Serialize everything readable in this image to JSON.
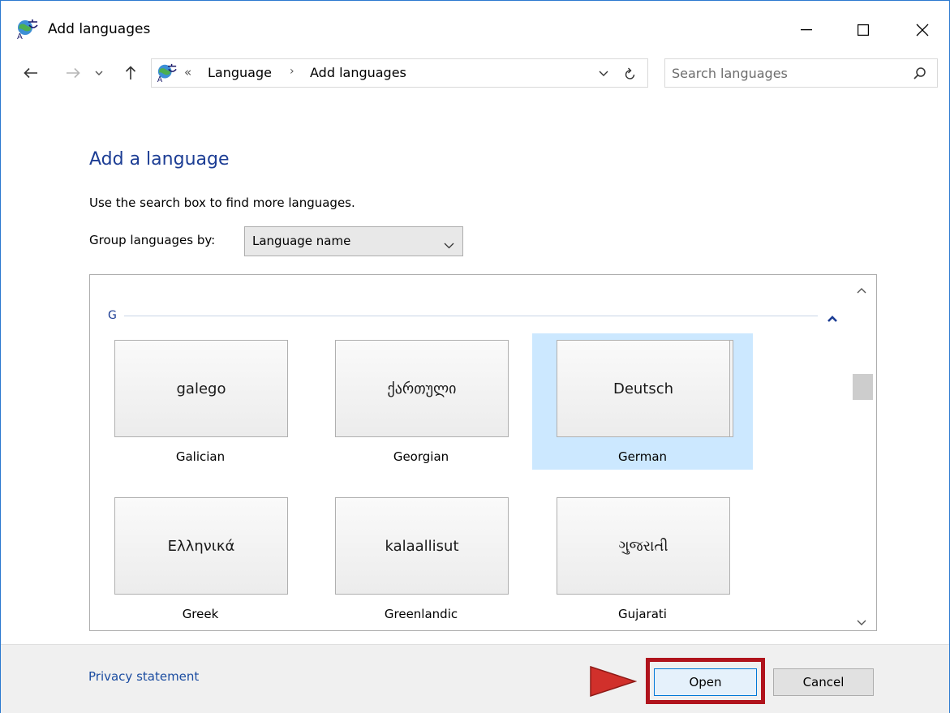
{
  "window": {
    "title": "Add languages",
    "accent_color": "#2b79d0"
  },
  "address_bar": {
    "overflow_chevrons": "«",
    "crumbs": [
      "Language",
      "Add languages"
    ],
    "separator": "›"
  },
  "search": {
    "placeholder": "Search languages"
  },
  "content": {
    "heading": "Add a language",
    "hint": "Use the search box to find more languages.",
    "group_by_label": "Group languages by:",
    "group_by_value": "Language name"
  },
  "group": {
    "letter": "G",
    "languages": [
      {
        "native": "galego",
        "english": "Galician",
        "selected": false
      },
      {
        "native": "ქართული",
        "english": "Georgian",
        "selected": false
      },
      {
        "native": "Deutsch",
        "english": "German",
        "selected": true
      },
      {
        "native": "Ελληνικά",
        "english": "Greek",
        "selected": false
      },
      {
        "native": "kalaallisut",
        "english": "Greenlandic",
        "selected": false
      },
      {
        "native": "ગુજરાતી",
        "english": "Gujarati",
        "selected": false
      }
    ]
  },
  "footer": {
    "privacy_link": "Privacy statement",
    "open_label": "Open",
    "cancel_label": "Cancel",
    "highlight_color": "#b0131c"
  }
}
